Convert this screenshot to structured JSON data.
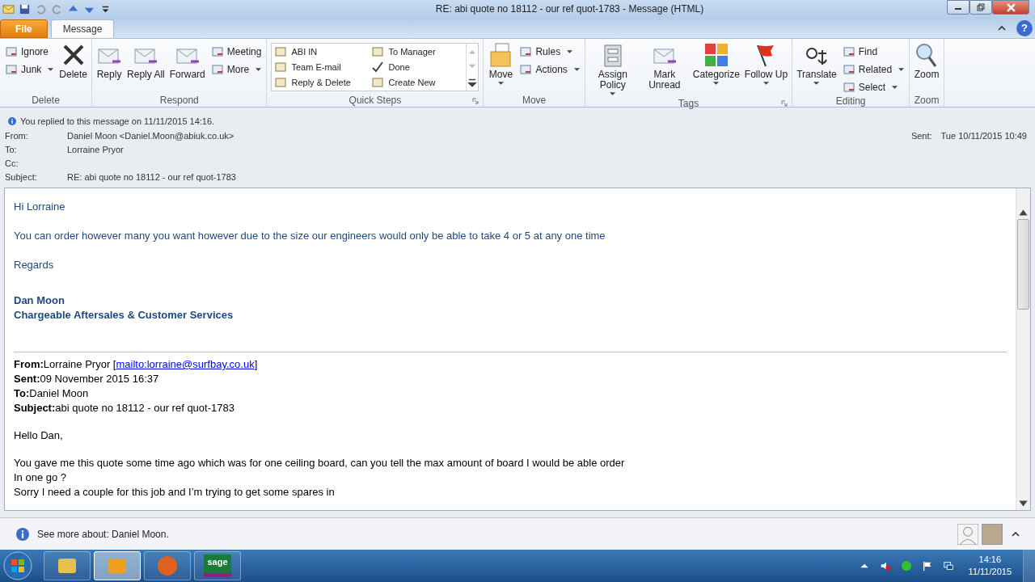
{
  "window": {
    "title": "RE: abi quote no 18112 - our ref quot-1783  -  Message (HTML)"
  },
  "tabs": [
    {
      "label": "File",
      "kind": "file",
      "selected": false
    },
    {
      "label": "Message",
      "kind": "tab",
      "selected": true
    }
  ],
  "help_button": {
    "label": "?"
  },
  "ribbon": {
    "groups": [
      {
        "label": "Delete",
        "kind": "buttons",
        "launcher": false,
        "buttons": [
          {
            "label": "Ignore",
            "kind": "small",
            "dropdown": false
          },
          {
            "label": "Junk",
            "kind": "small",
            "dropdown": true
          },
          {
            "label": "Delete",
            "kind": "large",
            "dropdown": false
          }
        ]
      },
      {
        "label": "Respond",
        "kind": "buttons",
        "launcher": false,
        "buttons": [
          {
            "label": "Reply",
            "kind": "large",
            "dropdown": false
          },
          {
            "label": "Reply All",
            "kind": "large",
            "dropdown": false
          },
          {
            "label": "Forward",
            "kind": "large",
            "dropdown": false
          },
          {
            "label": "Meeting",
            "kind": "small",
            "dropdown": false
          },
          {
            "label": "More",
            "kind": "small",
            "dropdown": true
          }
        ]
      },
      {
        "label": "Quick Steps",
        "kind": "gallery",
        "launcher": true,
        "items": [
          "ABI IN",
          "To Manager",
          "Team E-mail",
          "Done",
          "Reply & Delete",
          "Create New"
        ]
      },
      {
        "label": "Move",
        "kind": "buttons",
        "launcher": false,
        "buttons": [
          {
            "label": "Move",
            "kind": "large",
            "dropdown": true
          },
          {
            "label": "Rules",
            "kind": "small",
            "dropdown": true
          },
          {
            "label": "Actions",
            "kind": "small",
            "dropdown": true
          }
        ]
      },
      {
        "label": "Tags",
        "kind": "buttons",
        "launcher": true,
        "buttons": [
          {
            "label": "Assign Policy",
            "kind": "large",
            "dropdown": true
          },
          {
            "label": "Mark Unread",
            "kind": "large",
            "dropdown": false
          },
          {
            "label": "Categorize",
            "kind": "large",
            "dropdown": true
          },
          {
            "label": "Follow Up",
            "kind": "large",
            "dropdown": true
          }
        ]
      },
      {
        "label": "Editing",
        "kind": "buttons",
        "launcher": false,
        "buttons": [
          {
            "label": "Translate",
            "kind": "large",
            "dropdown": true
          },
          {
            "label": "Find",
            "kind": "small",
            "dropdown": false
          },
          {
            "label": "Related",
            "kind": "small",
            "dropdown": true
          },
          {
            "label": "Select",
            "kind": "small",
            "dropdown": true
          }
        ]
      },
      {
        "label": "Zoom",
        "kind": "buttons",
        "launcher": false,
        "buttons": [
          {
            "label": "Zoom",
            "kind": "large",
            "dropdown": false
          }
        ]
      }
    ]
  },
  "header": {
    "info": "You replied to this message on 11/11/2015 14:16.",
    "fields": [
      {
        "label": "From:",
        "value": "Daniel Moon <Daniel.Moon@abiuk.co.uk>"
      },
      {
        "label": "To:",
        "value": "Lorraine Pryor"
      },
      {
        "label": "Cc:"
      },
      {
        "label": "Subject:",
        "value": "RE: abi quote no 18112 - our ref quot-1783"
      }
    ],
    "sent": {
      "label": "Sent:",
      "value": "Tue 10/11/2015 10:49"
    }
  },
  "body": {
    "reply": [
      "Hi Lorraine",
      "You can order however many you want however due to the size our engineers would only be able to take 4 or 5 at any one time",
      "Regards"
    ],
    "signature": [
      "Dan Moon",
      "Chargeable Aftersales & Customer Services"
    ],
    "quoted_header": [
      {
        "label": "From:",
        "value": "Lorraine Pryor [",
        "link": "mailto:lorraine@surfbay.co.uk",
        "after": "]"
      },
      {
        "label": "Sent:",
        "value": "09 November 2015 16:37"
      },
      {
        "label": "To:",
        "value": "Daniel Moon"
      },
      {
        "label": "Subject:",
        "value": "abi quote no 18112 - our ref quot-1783"
      }
    ],
    "quoted": [
      [
        "Hello Dan,"
      ],
      [
        "You gave me this quote some time ago which was for one ceiling board, can you tell the max amount of board I would be able order",
        "In one go ?",
        "Sorry I need a couple for this job and I’m trying to get some spares in"
      ]
    ]
  },
  "people_pane": {
    "text": "See more about: Daniel Moon."
  },
  "taskbar": {
    "apps": [
      {
        "kind": "explorer",
        "selected": false
      },
      {
        "kind": "outlook",
        "selected": true
      },
      {
        "kind": "firefox",
        "selected": false
      },
      {
        "kind": "sage",
        "label": "sage",
        "selected": false
      }
    ],
    "time": "14:16",
    "date": "11/11/2015"
  }
}
